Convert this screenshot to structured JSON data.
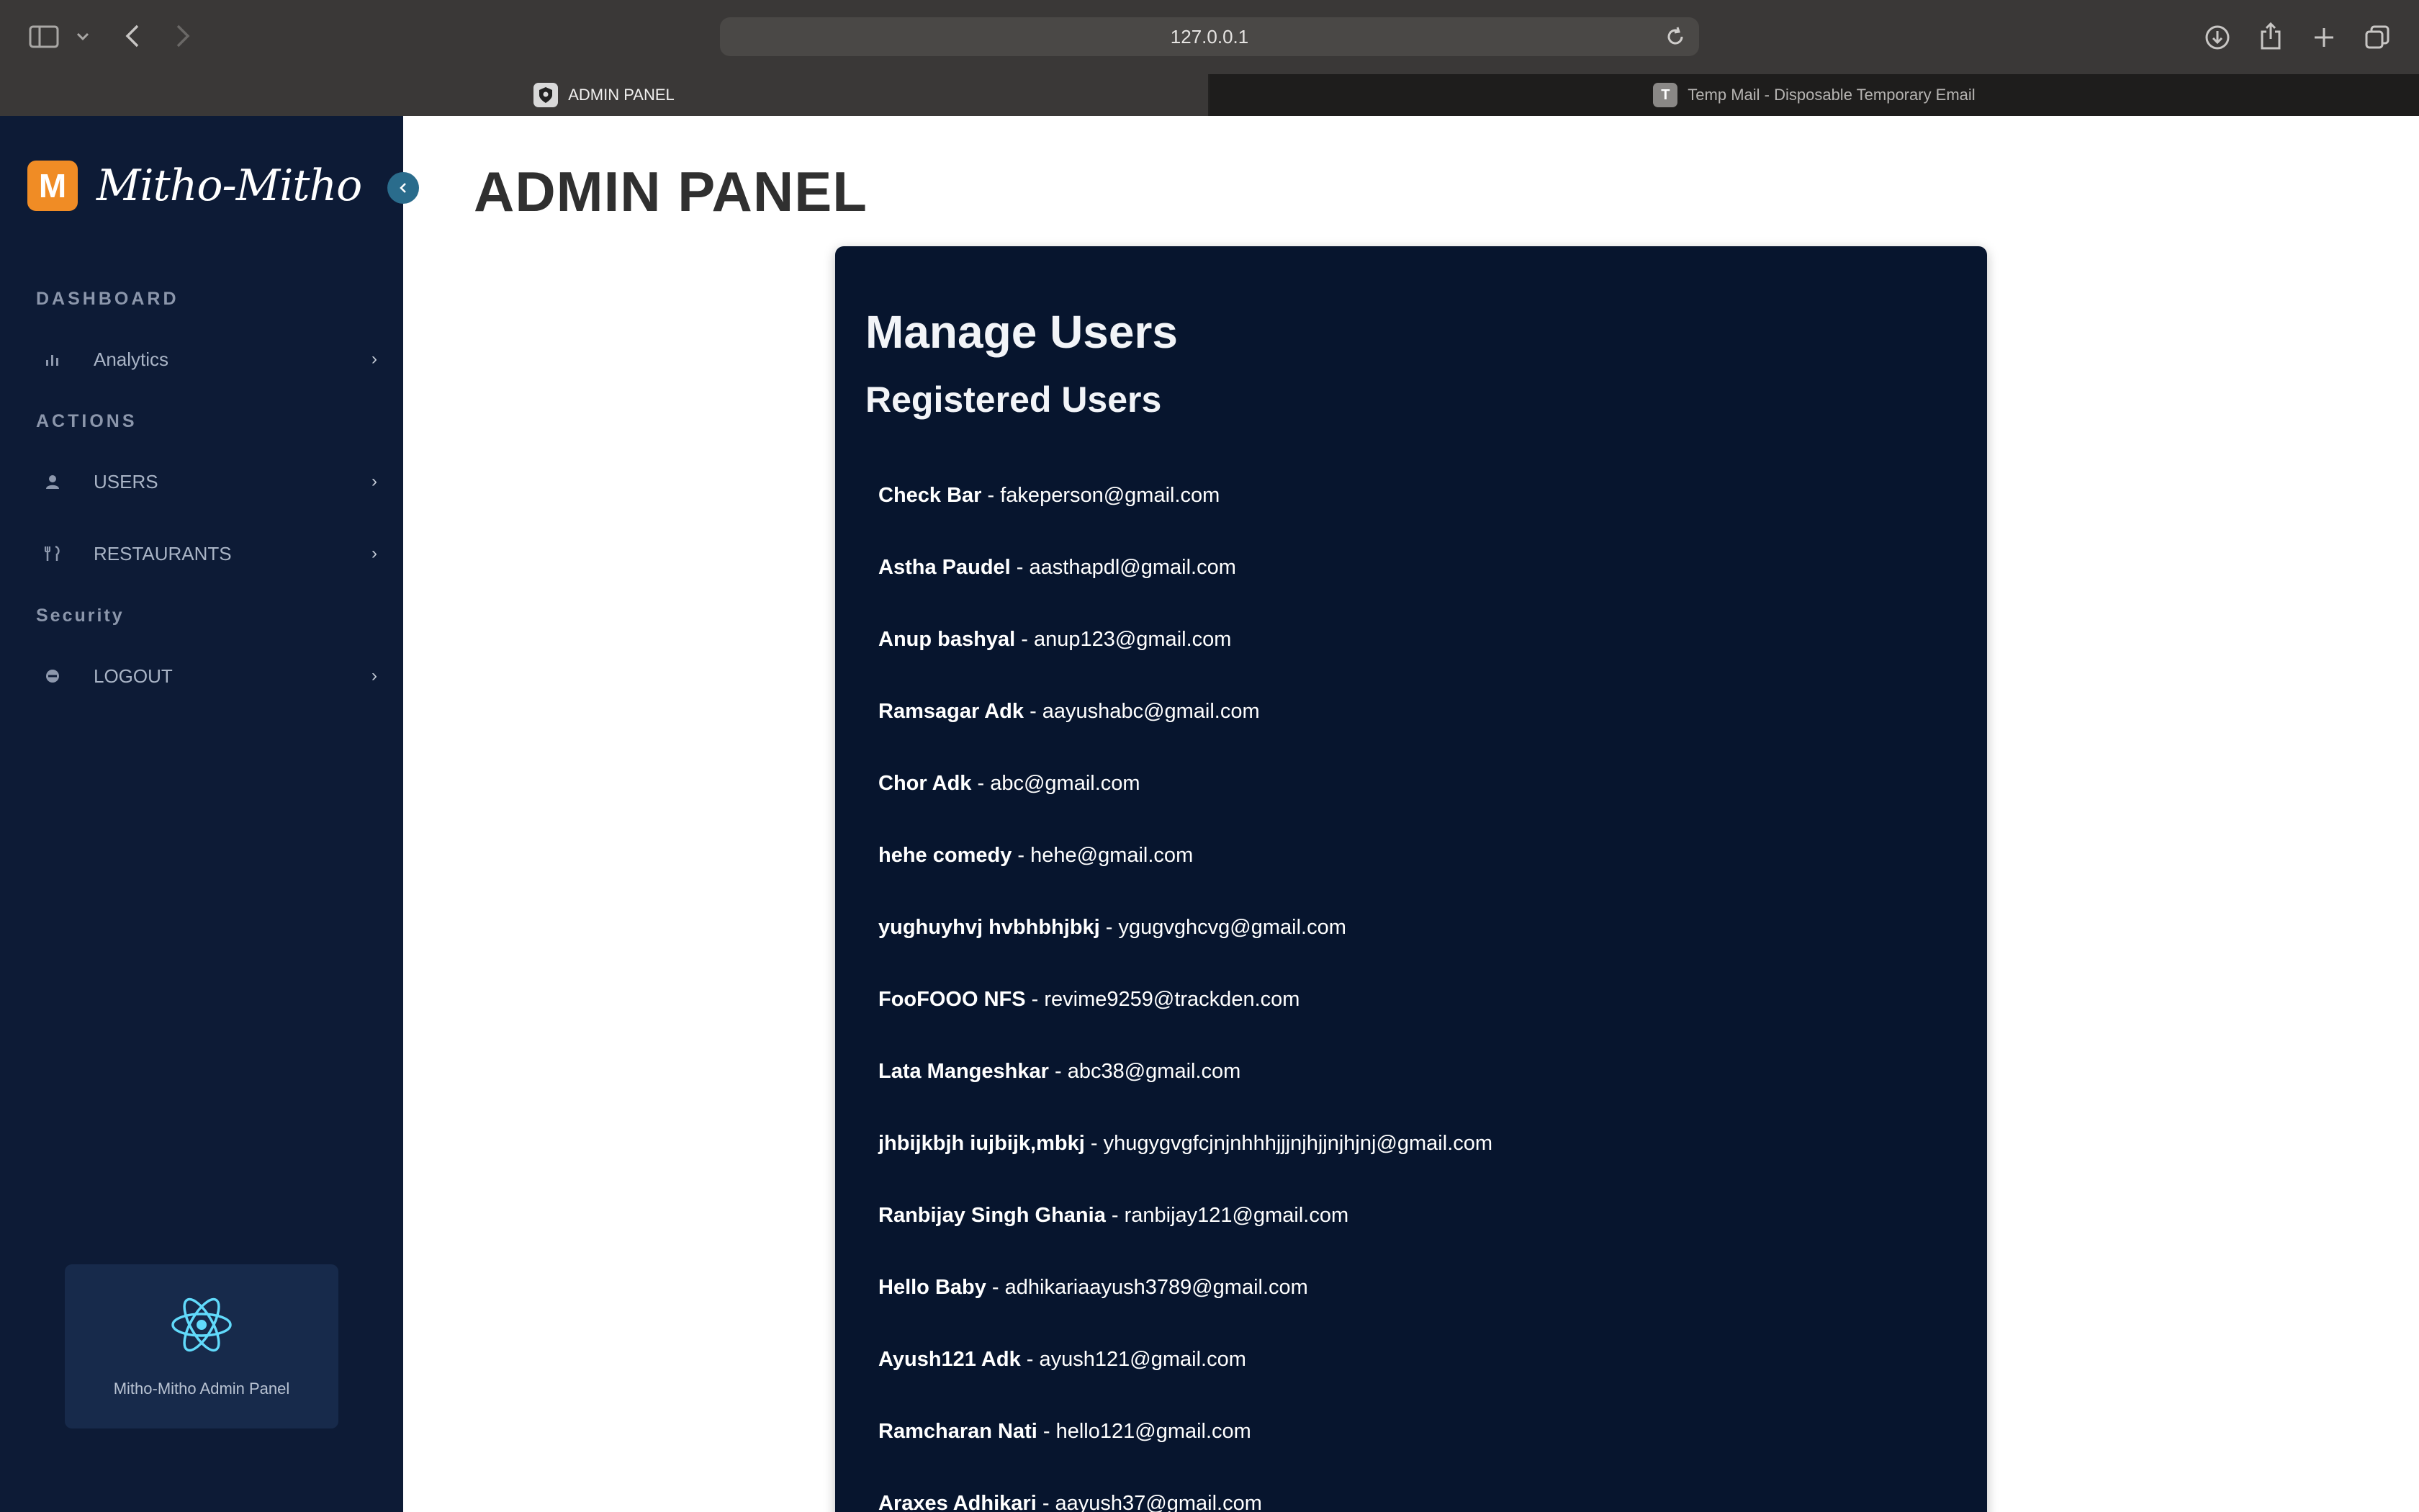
{
  "browser": {
    "url": "127.0.0.1",
    "tabs": [
      {
        "label": "ADMIN PANEL"
      },
      {
        "label": "Temp Mail - Disposable Temporary Email",
        "favicon_letter": "T"
      }
    ]
  },
  "sidebar": {
    "brand_initial": "M",
    "brand_name": "Mitho-Mitho",
    "sections": {
      "dashboard": "DASHBOARD",
      "actions": "ACTIONS",
      "security": "Security"
    },
    "items": {
      "analytics": "Analytics",
      "users": "USERS",
      "restaurants": "RESTAURANTS",
      "logout": "LOGOUT"
    },
    "footer_label": "Mitho-Mitho Admin Panel",
    "accent_color": "#f08c25"
  },
  "main": {
    "page_title": "ADMIN PANEL",
    "card_title": "Manage Users",
    "card_subtitle": "Registered Users",
    "separator": " - ",
    "users": [
      {
        "name": "Check Bar",
        "email": "fakeperson@gmail.com"
      },
      {
        "name": "Astha Paudel",
        "email": "aasthapdl@gmail.com"
      },
      {
        "name": "Anup bashyal",
        "email": "anup123@gmail.com"
      },
      {
        "name": "Ramsagar Adk",
        "email": "aayushabc@gmail.com"
      },
      {
        "name": "Chor Adk",
        "email": "abc@gmail.com"
      },
      {
        "name": "hehe comedy",
        "email": "hehe@gmail.com"
      },
      {
        "name": "yughuyhvj hvbhbhjbkj",
        "email": "ygugvghcvg@gmail.com"
      },
      {
        "name": "FooFOOO NFS",
        "email": "revime9259@trackden.com"
      },
      {
        "name": "Lata Mangeshkar",
        "email": "abc38@gmail.com"
      },
      {
        "name": "jhbijkbjh iujbijk,mbkj",
        "email": "yhugygvgfcjnjnhhhjjjnjhjjnjhjnj@gmail.com"
      },
      {
        "name": "Ranbijay Singh Ghania",
        "email": "ranbijay121@gmail.com"
      },
      {
        "name": "Hello Baby",
        "email": "adhikariaayush3789@gmail.com"
      },
      {
        "name": "Ayush121 Adk",
        "email": "ayush121@gmail.com"
      },
      {
        "name": "Ramcharan Nati",
        "email": "hello121@gmail.com"
      },
      {
        "name": "Araxes Adhikari",
        "email": "aayush37@gmail.com"
      }
    ]
  }
}
